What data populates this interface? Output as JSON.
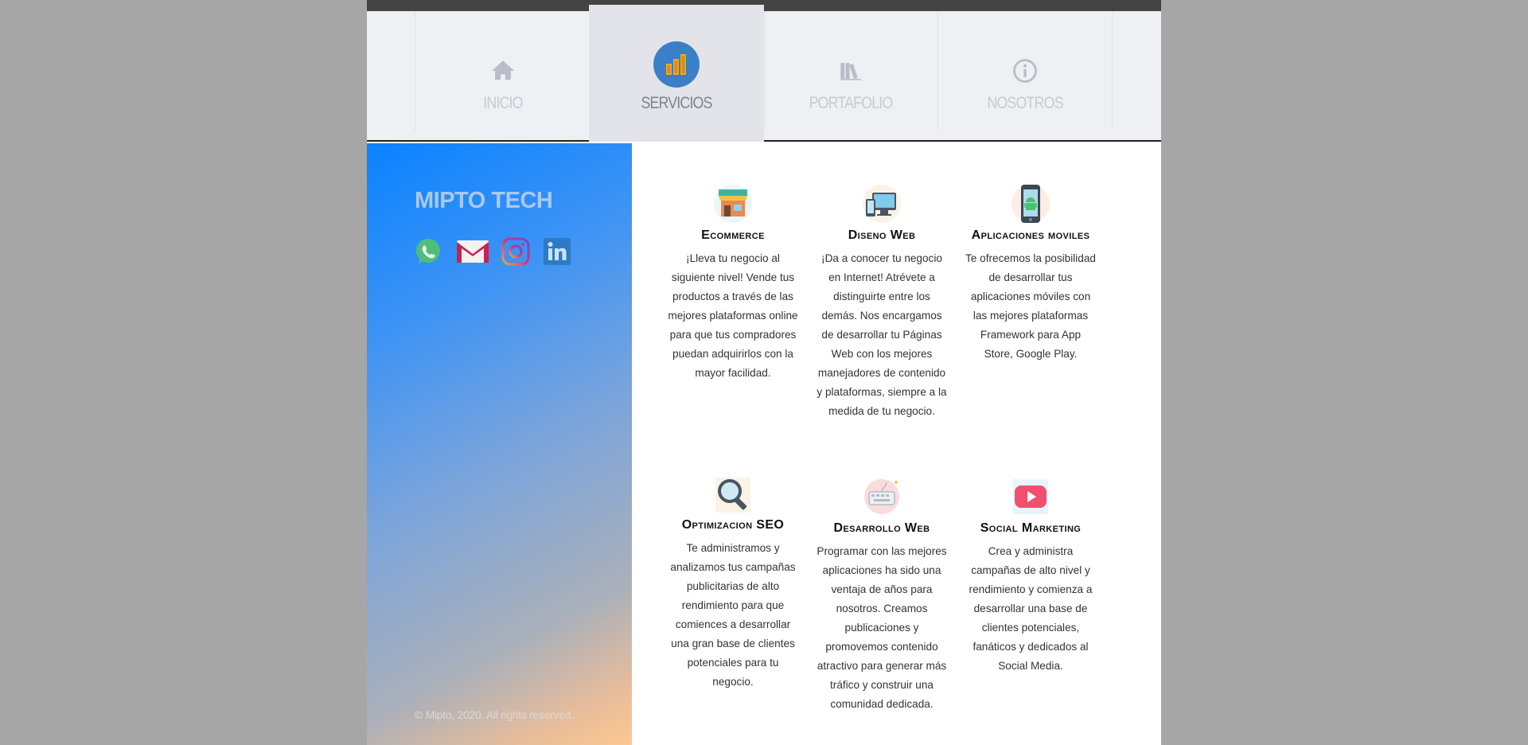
{
  "nav": {
    "items": [
      {
        "label": "INICIO",
        "icon": "home-icon"
      },
      {
        "label": "SERVICIOS",
        "icon": "bar-chart-icon",
        "active": true
      },
      {
        "label": "PORTAFOLIO",
        "icon": "books-icon"
      },
      {
        "label": "NOSOTROS",
        "icon": "info-icon"
      }
    ]
  },
  "sidebar": {
    "brand": "MIPTO TECH",
    "socials": [
      "whatsapp-icon",
      "gmail-icon",
      "instagram-icon",
      "linkedin-icon"
    ],
    "copyright": "© Mipto, 2020. All rights reserved."
  },
  "services": [
    {
      "title": "Ecommerce",
      "icon": "store-icon",
      "text": "¡Lleva tu negocio al siguiente nivel! Vende tus productos a través de las mejores plataformas online para que tus compradores puedan adquirirlos con la mayor facilidad."
    },
    {
      "title": "Diseno Web",
      "icon": "devices-icon",
      "text": "¡Da a conocer tu negocio en Internet! Atrévete a distinguirte entre los demás. Nos encargamos de desarrollar tu Páginas Web con los mejores manejadores de contenido y plataformas, siempre a la medida de tu negocio."
    },
    {
      "title": "Aplicaciones moviles",
      "icon": "android-phone-icon",
      "text": "Te ofrecemos la posibilidad de desarrollar tus aplicaciones móviles con las mejores plataformas Framework para App Store, Google Play."
    },
    {
      "title": "Optimizacion SEO",
      "icon": "magnifier-icon",
      "text": "Te administramos y analizamos tus campañas publicitarias de alto rendimiento para que comiences a desarrollar una gran base de clientes potenciales para tu negocio."
    },
    {
      "title": "Desarrollo Web",
      "icon": "keyboard-icon",
      "text": "Programar con las mejores aplicaciones ha sido una ventaja de años para nosotros. Creamos publicaciones y promovemos contenido atractivo para generar más tráfico y construir una comunidad dedicada."
    },
    {
      "title": "Social Marketing",
      "icon": "youtube-play-icon",
      "text": "Crea y administra campañas de alto nivel y rendimiento y comienza a desarrollar una base de clientes potenciales, fanáticos y dedicados al Social Media."
    }
  ],
  "colors": {
    "active_badge": "#3a7fc7",
    "bar_orange": "#f5a623",
    "nav_bg": "#eff0f4",
    "nav_active_bg": "#e3e4e9"
  }
}
